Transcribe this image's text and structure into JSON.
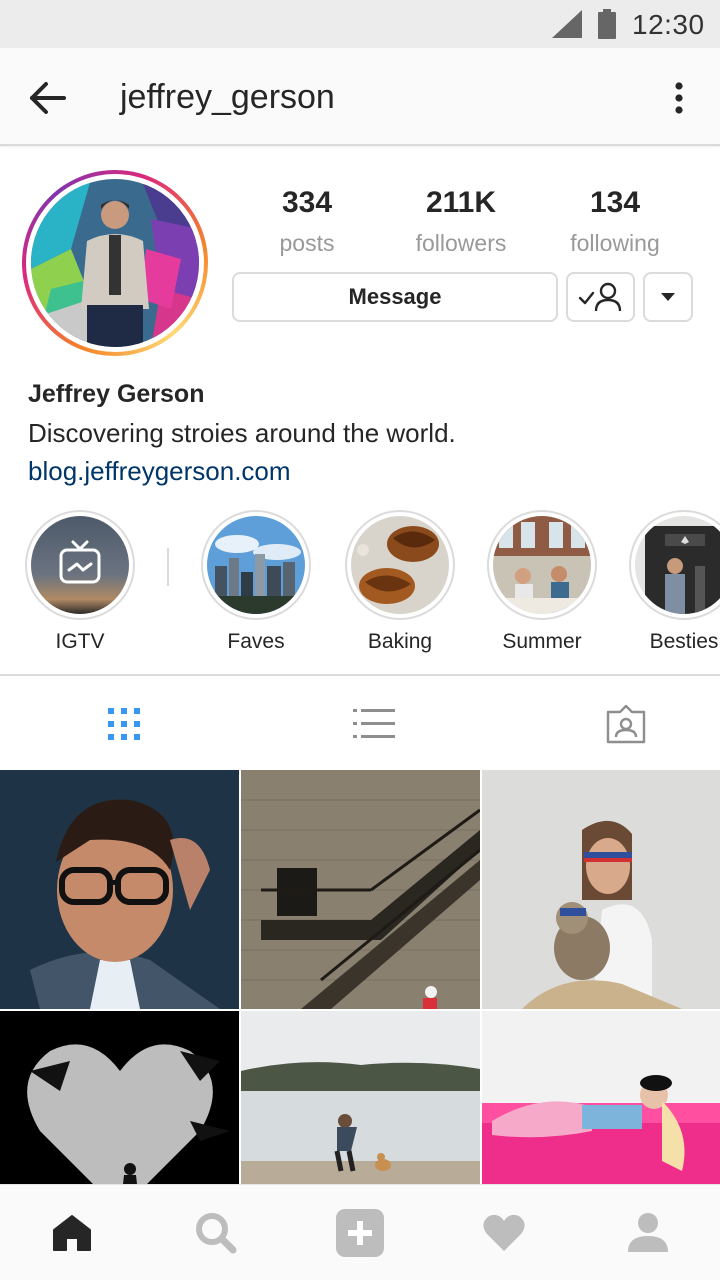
{
  "status_bar": {
    "time": "12:30"
  },
  "header": {
    "username": "jeffrey_gerson"
  },
  "profile": {
    "stats": [
      {
        "value": "334",
        "label": "posts"
      },
      {
        "value": "211K",
        "label": "followers"
      },
      {
        "value": "134",
        "label": "following"
      }
    ],
    "message_label": "Message",
    "name": "Jeffrey Gerson",
    "bio": "Discovering stroies around the world.",
    "link": "blog.jeffreygerson.com"
  },
  "highlights": [
    {
      "label": "IGTV"
    },
    {
      "label": "Faves"
    },
    {
      "label": "Baking"
    },
    {
      "label": "Summer"
    },
    {
      "label": "Besties"
    }
  ],
  "colors": {
    "accent_blue": "#3897f0",
    "link": "#003569",
    "border": "#dbdbdb",
    "muted": "#999999"
  },
  "icons": {
    "tabs": [
      "grid-icon",
      "list-icon",
      "tagged-icon"
    ],
    "bottom_nav": [
      "home-icon",
      "search-icon",
      "add-post-icon",
      "activity-heart-icon",
      "profile-icon"
    ]
  }
}
